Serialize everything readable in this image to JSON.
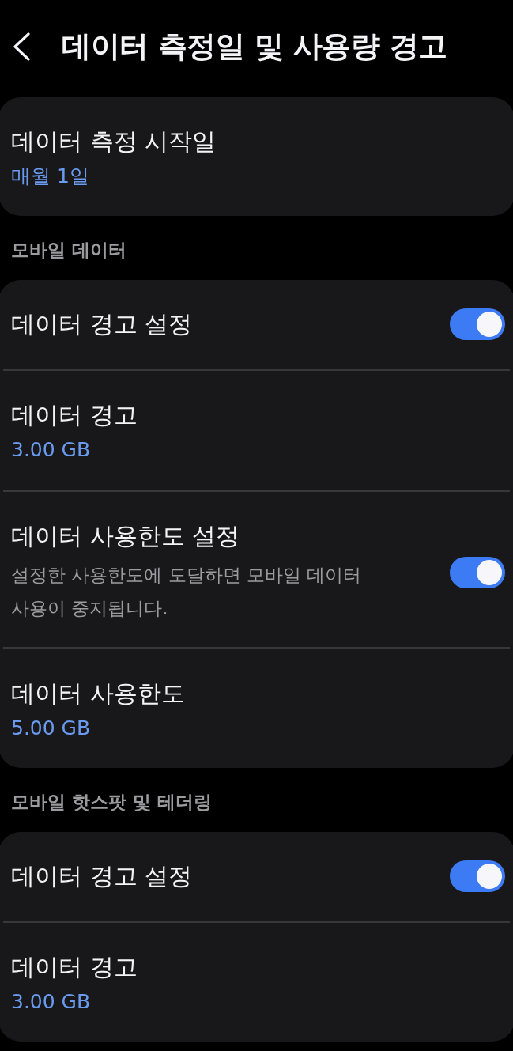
{
  "header": {
    "title": "데이터 측정일 및 사용량 경고"
  },
  "sections": [
    {
      "items": [
        {
          "kind": "value",
          "title": "데이터 측정 시작일",
          "value": "매월 1일"
        }
      ]
    },
    {
      "heading": "모바일 데이터",
      "items": [
        {
          "kind": "toggle",
          "title": "데이터 경고 설정",
          "on": true
        },
        {
          "kind": "value",
          "title": "데이터 경고",
          "value": "3.00 GB"
        },
        {
          "kind": "toggle",
          "title": "데이터 사용한도 설정",
          "subtitle": "설정한 사용한도에 도달하면 모바일 데이터 사용이 중지됩니다.",
          "on": true
        },
        {
          "kind": "value",
          "title": "데이터 사용한도",
          "value": "5.00 GB"
        }
      ]
    },
    {
      "heading": "모바일 핫스팟 및 테더링",
      "items": [
        {
          "kind": "toggle",
          "title": "데이터 경고 설정",
          "on": true
        },
        {
          "kind": "value",
          "title": "데이터 경고",
          "value": "3.00 GB"
        }
      ]
    }
  ]
}
